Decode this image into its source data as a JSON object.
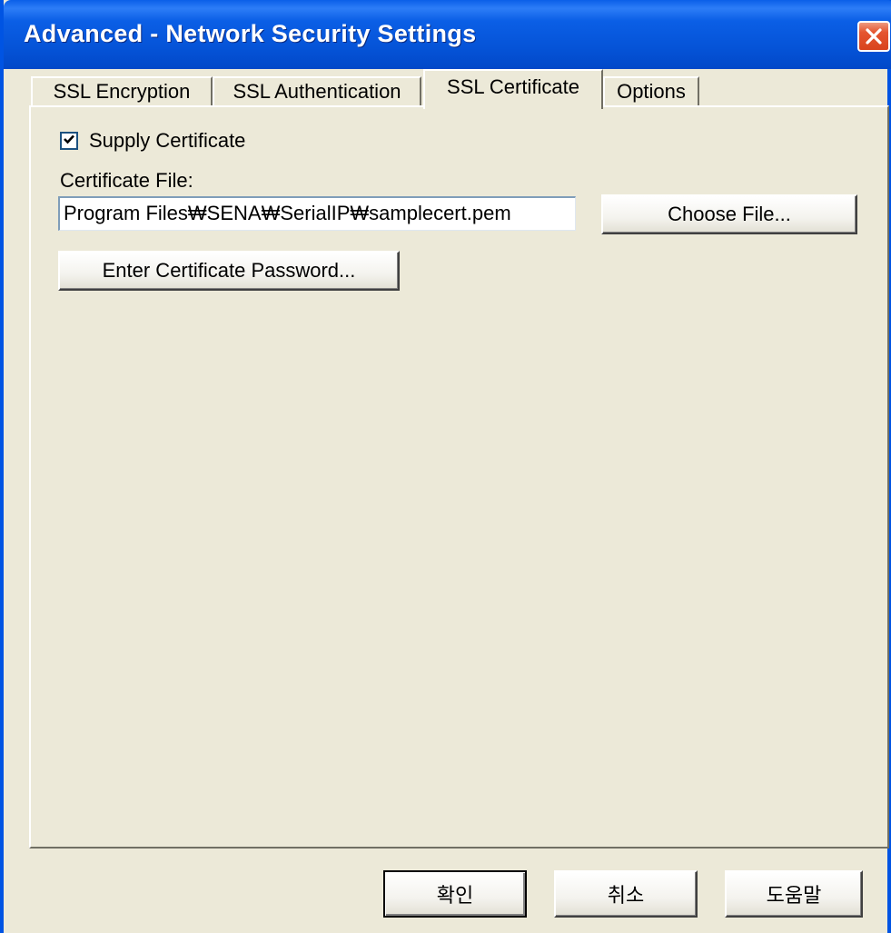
{
  "window": {
    "title": "Advanced - Network Security Settings"
  },
  "tabs": [
    {
      "label": "SSL Encryption",
      "active": false
    },
    {
      "label": "SSL Authentication",
      "active": false
    },
    {
      "label": "SSL Certificate",
      "active": true
    },
    {
      "label": "Options",
      "active": false
    }
  ],
  "certificate": {
    "supply_label": "Supply Certificate",
    "supply_checked": true,
    "file_label": "Certificate File:",
    "file_value": "Program Files₩SENA₩SerialIP₩samplecert.pem",
    "choose_file_label": "Choose File...",
    "password_button_label": "Enter Certificate Password..."
  },
  "footer": {
    "ok_label": "확인",
    "cancel_label": "취소",
    "help_label": "도움말"
  },
  "colors": {
    "titlebar": "#0553d7",
    "dialog_bg": "#ece9d8",
    "close_button": "#e5552f"
  }
}
